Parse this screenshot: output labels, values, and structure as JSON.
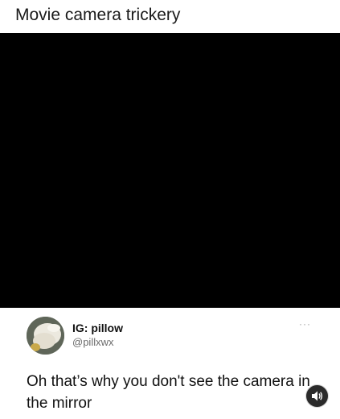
{
  "post": {
    "title": "Movie camera trickery"
  },
  "tweet": {
    "display_name": "IG: pillow",
    "handle": "@pillxwx",
    "more_label": "···",
    "text": "Oh that’s why you don't see the camera in the mirror"
  },
  "video": {
    "background_color": "#000000"
  },
  "icons": {
    "sound": "speaker-icon",
    "more": "more-icon"
  }
}
